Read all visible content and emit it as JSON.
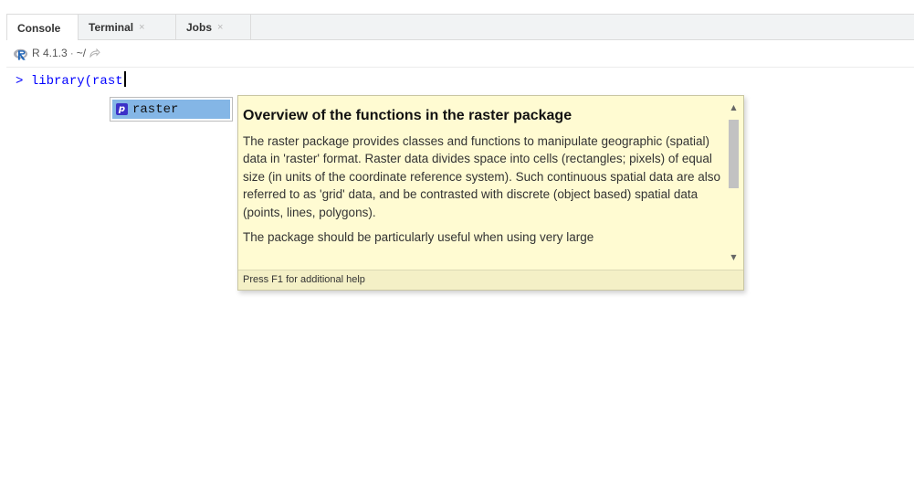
{
  "tabs": [
    {
      "label": "Console",
      "closable": false,
      "active": true
    },
    {
      "label": "Terminal",
      "closable": true,
      "active": false
    },
    {
      "label": "Jobs",
      "closable": true,
      "active": false
    }
  ],
  "tab_close_glyph": "×",
  "toolbar": {
    "r_version": "R 4.1.3",
    "separator": "·",
    "working_dir": "~/",
    "r_logo_icon": "r-logo-icon",
    "link_icon": "external-link-icon"
  },
  "console": {
    "prompt": ">",
    "input_text": "library(rast"
  },
  "completion": {
    "items": [
      {
        "badge": "p",
        "label": "raster",
        "selected": true
      }
    ],
    "selected_color": "#84b6e6"
  },
  "help_popup": {
    "title": "Overview of the functions in the raster package",
    "paragraphs": [
      "The raster package provides classes and functions to manipulate geographic (spatial) data in 'raster' format. Raster data divides space into cells (rectangles; pixels) of equal size (in units of the coordinate reference system). Such continuous spatial data are also referred to as 'grid' data, and be contrasted with discrete (object based) spatial data (points, lines, polygons).",
      "The package should be particularly useful when using very large"
    ],
    "footer": "Press F1 for additional help",
    "background": "#fffbd2"
  },
  "colors": {
    "prompt_blue": "#0000ff",
    "tab_bar_bg": "#f1f3f4"
  }
}
